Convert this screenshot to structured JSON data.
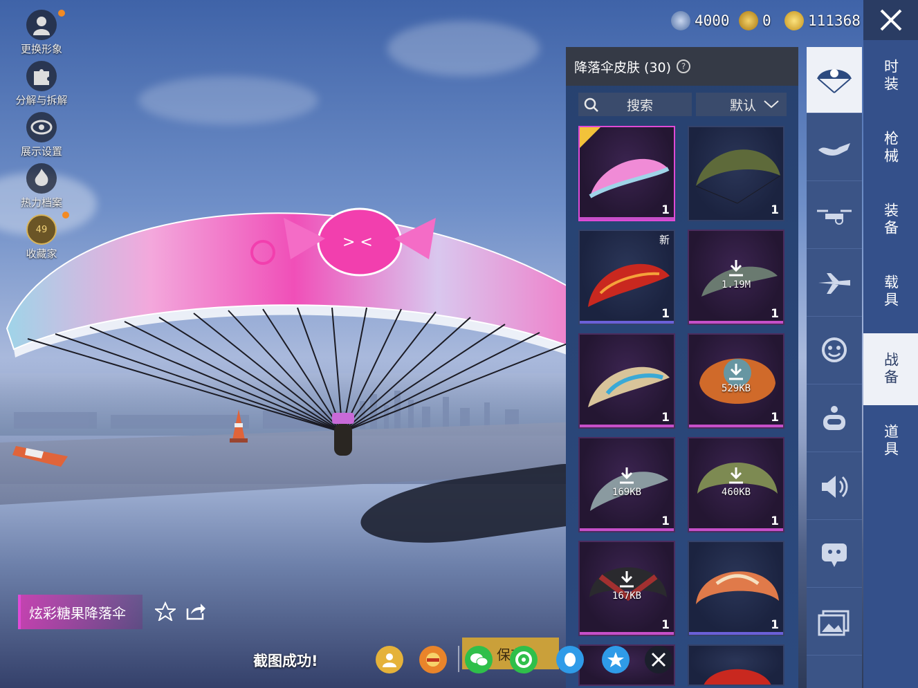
{
  "currencies": [
    {
      "icon": "silver-coin-icon",
      "value": "4000",
      "color": "#8aa0c8"
    },
    {
      "icon": "ag-coin-icon",
      "value": "0",
      "color": "#d8a726"
    },
    {
      "icon": "bp-coin-icon",
      "value": "111368",
      "color": "#e0b23b"
    }
  ],
  "left_menu": [
    {
      "label": "更换形象",
      "icon": "avatar-icon"
    },
    {
      "label": "分解与拆解",
      "icon": "puzzle-icon"
    },
    {
      "label": "展示设置",
      "icon": "eye-icon"
    },
    {
      "label": "热力档案",
      "icon": "flame-icon"
    },
    {
      "label": "收藏家",
      "icon": "collector-badge-icon",
      "badge": "49"
    }
  ],
  "panel": {
    "title": "降落伞皮肤 (30)",
    "search_label": "搜索",
    "sort_label": "默认"
  },
  "items": [
    {
      "count": "1",
      "selected": true,
      "style": "purple",
      "chute": "#f08bd6"
    },
    {
      "count": "1",
      "style": "blue",
      "chute": "#5e6a3a"
    },
    {
      "count": "1",
      "badge": "新",
      "style": "blue",
      "chute": "#c9281f"
    },
    {
      "count": "1",
      "download": "1.19M",
      "style": "purple",
      "chute": "#6a7a70"
    },
    {
      "count": "1",
      "style": "purple",
      "chute": "#3aa9d6"
    },
    {
      "count": "1",
      "download": "529KB",
      "style": "purple",
      "chute": "#d06a2a"
    },
    {
      "count": "1",
      "download": "169KB",
      "style": "purple",
      "chute": "#8a9aa0"
    },
    {
      "count": "1",
      "download": "460KB",
      "style": "purple",
      "chute": "#7d8a52"
    },
    {
      "count": "1",
      "download": "167KB",
      "style": "purple",
      "chute": "#a23030"
    },
    {
      "count": "1",
      "style": "blue",
      "chute": "#e07a4a"
    }
  ],
  "categories": [
    {
      "icon": "parachute-icon",
      "active": true
    },
    {
      "icon": "skydiver-icon"
    },
    {
      "icon": "drone-icon"
    },
    {
      "icon": "plane-icon"
    },
    {
      "icon": "emote-face-icon"
    },
    {
      "icon": "robot-icon"
    },
    {
      "icon": "speaker-icon"
    },
    {
      "icon": "chat-bubble-icon"
    },
    {
      "icon": "image-icon"
    }
  ],
  "tabs": [
    {
      "label": "时装"
    },
    {
      "label": "枪械"
    },
    {
      "label": "装备"
    },
    {
      "label": "载具"
    },
    {
      "label": "战备",
      "active": true
    },
    {
      "label": "道具"
    }
  ],
  "item_name": "炫彩糖果降落伞",
  "toast": "截图成功!",
  "save_label": "保存"
}
